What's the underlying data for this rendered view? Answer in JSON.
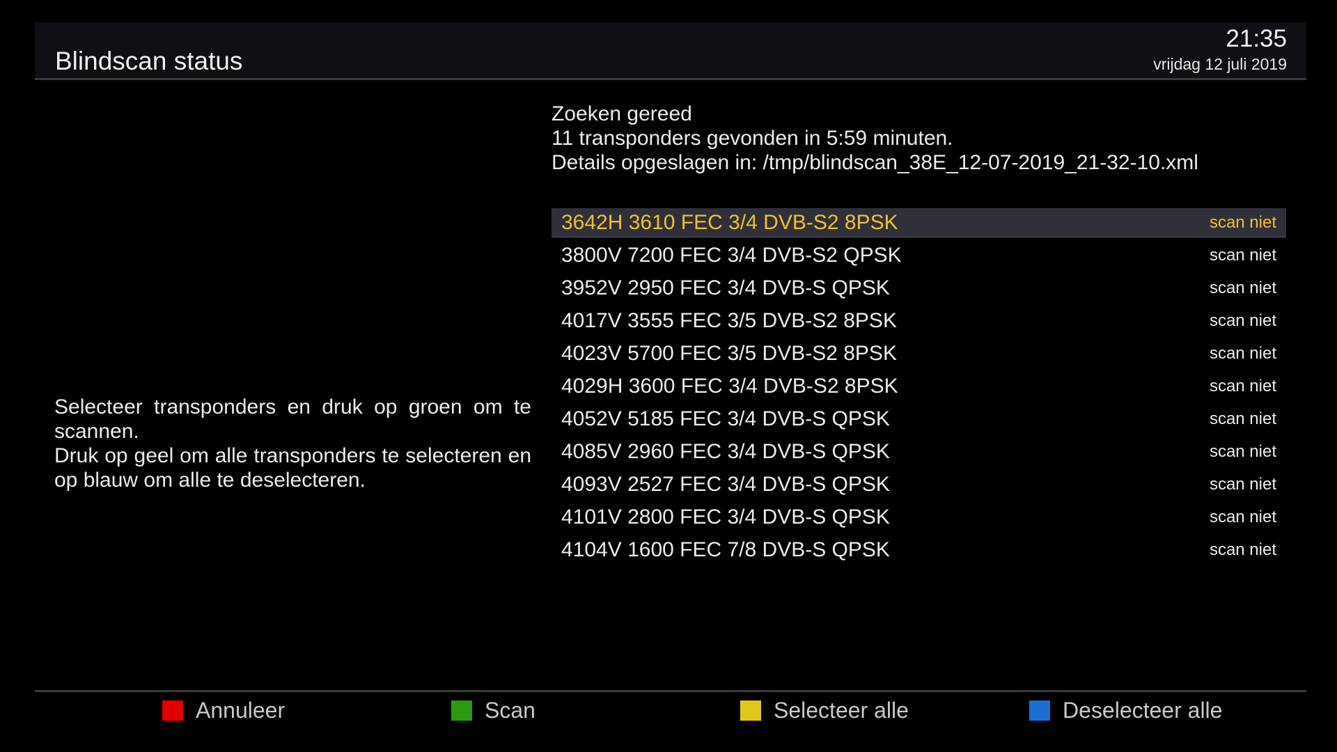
{
  "header": {
    "title": "Blindscan status",
    "time": "21:35",
    "date": "vrijdag 12 juli 2019"
  },
  "status": {
    "lines": [
      "Zoeken gereed",
      "11 transponders gevonden in 5:59 minuten.",
      "Details opgeslagen in: /tmp/blindscan_38E_12-07-2019_21-32-10.xml"
    ]
  },
  "help": {
    "lines": [
      "Selecteer transponders en druk op groen om te scannen.",
      "Druk op geel om alle transponders te selecteren en op blauw om alle te deselecteren."
    ]
  },
  "transponders": {
    "selected_index": 0,
    "items": [
      {
        "name": "3642H 3610 FEC 3/4 DVB-S2 8PSK",
        "status": "scan niet"
      },
      {
        "name": "3800V 7200 FEC 3/4 DVB-S2 QPSK",
        "status": "scan niet"
      },
      {
        "name": "3952V 2950 FEC 3/4 DVB-S QPSK",
        "status": "scan niet"
      },
      {
        "name": "4017V 3555 FEC 3/5 DVB-S2 8PSK",
        "status": "scan niet"
      },
      {
        "name": "4023V 5700 FEC 3/5 DVB-S2 8PSK",
        "status": "scan niet"
      },
      {
        "name": "4029H 3600 FEC 3/4 DVB-S2 8PSK",
        "status": "scan niet"
      },
      {
        "name": "4052V 5185 FEC 3/4 DVB-S QPSK",
        "status": "scan niet"
      },
      {
        "name": "4085V 2960 FEC 3/4 DVB-S QPSK",
        "status": "scan niet"
      },
      {
        "name": "4093V 2527 FEC 3/4 DVB-S QPSK",
        "status": "scan niet"
      },
      {
        "name": "4101V 2800 FEC 3/4 DVB-S QPSK",
        "status": "scan niet"
      },
      {
        "name": "4104V 1600 FEC 7/8 DVB-S QPSK",
        "status": "scan niet"
      }
    ]
  },
  "footer": {
    "buttons": [
      {
        "label": "Annuleer",
        "color": "#e00000",
        "icon": "red-key-icon"
      },
      {
        "label": "Scan",
        "color": "#2a9a10",
        "icon": "green-key-icon"
      },
      {
        "label": "Selecteer alle",
        "color": "#e0c818",
        "icon": "yellow-key-icon"
      },
      {
        "label": "Deselecteer alle",
        "color": "#1a6fd0",
        "icon": "blue-key-icon"
      }
    ]
  },
  "colors": {
    "highlight_text": "#f0c030",
    "highlight_background": "#30303a"
  }
}
